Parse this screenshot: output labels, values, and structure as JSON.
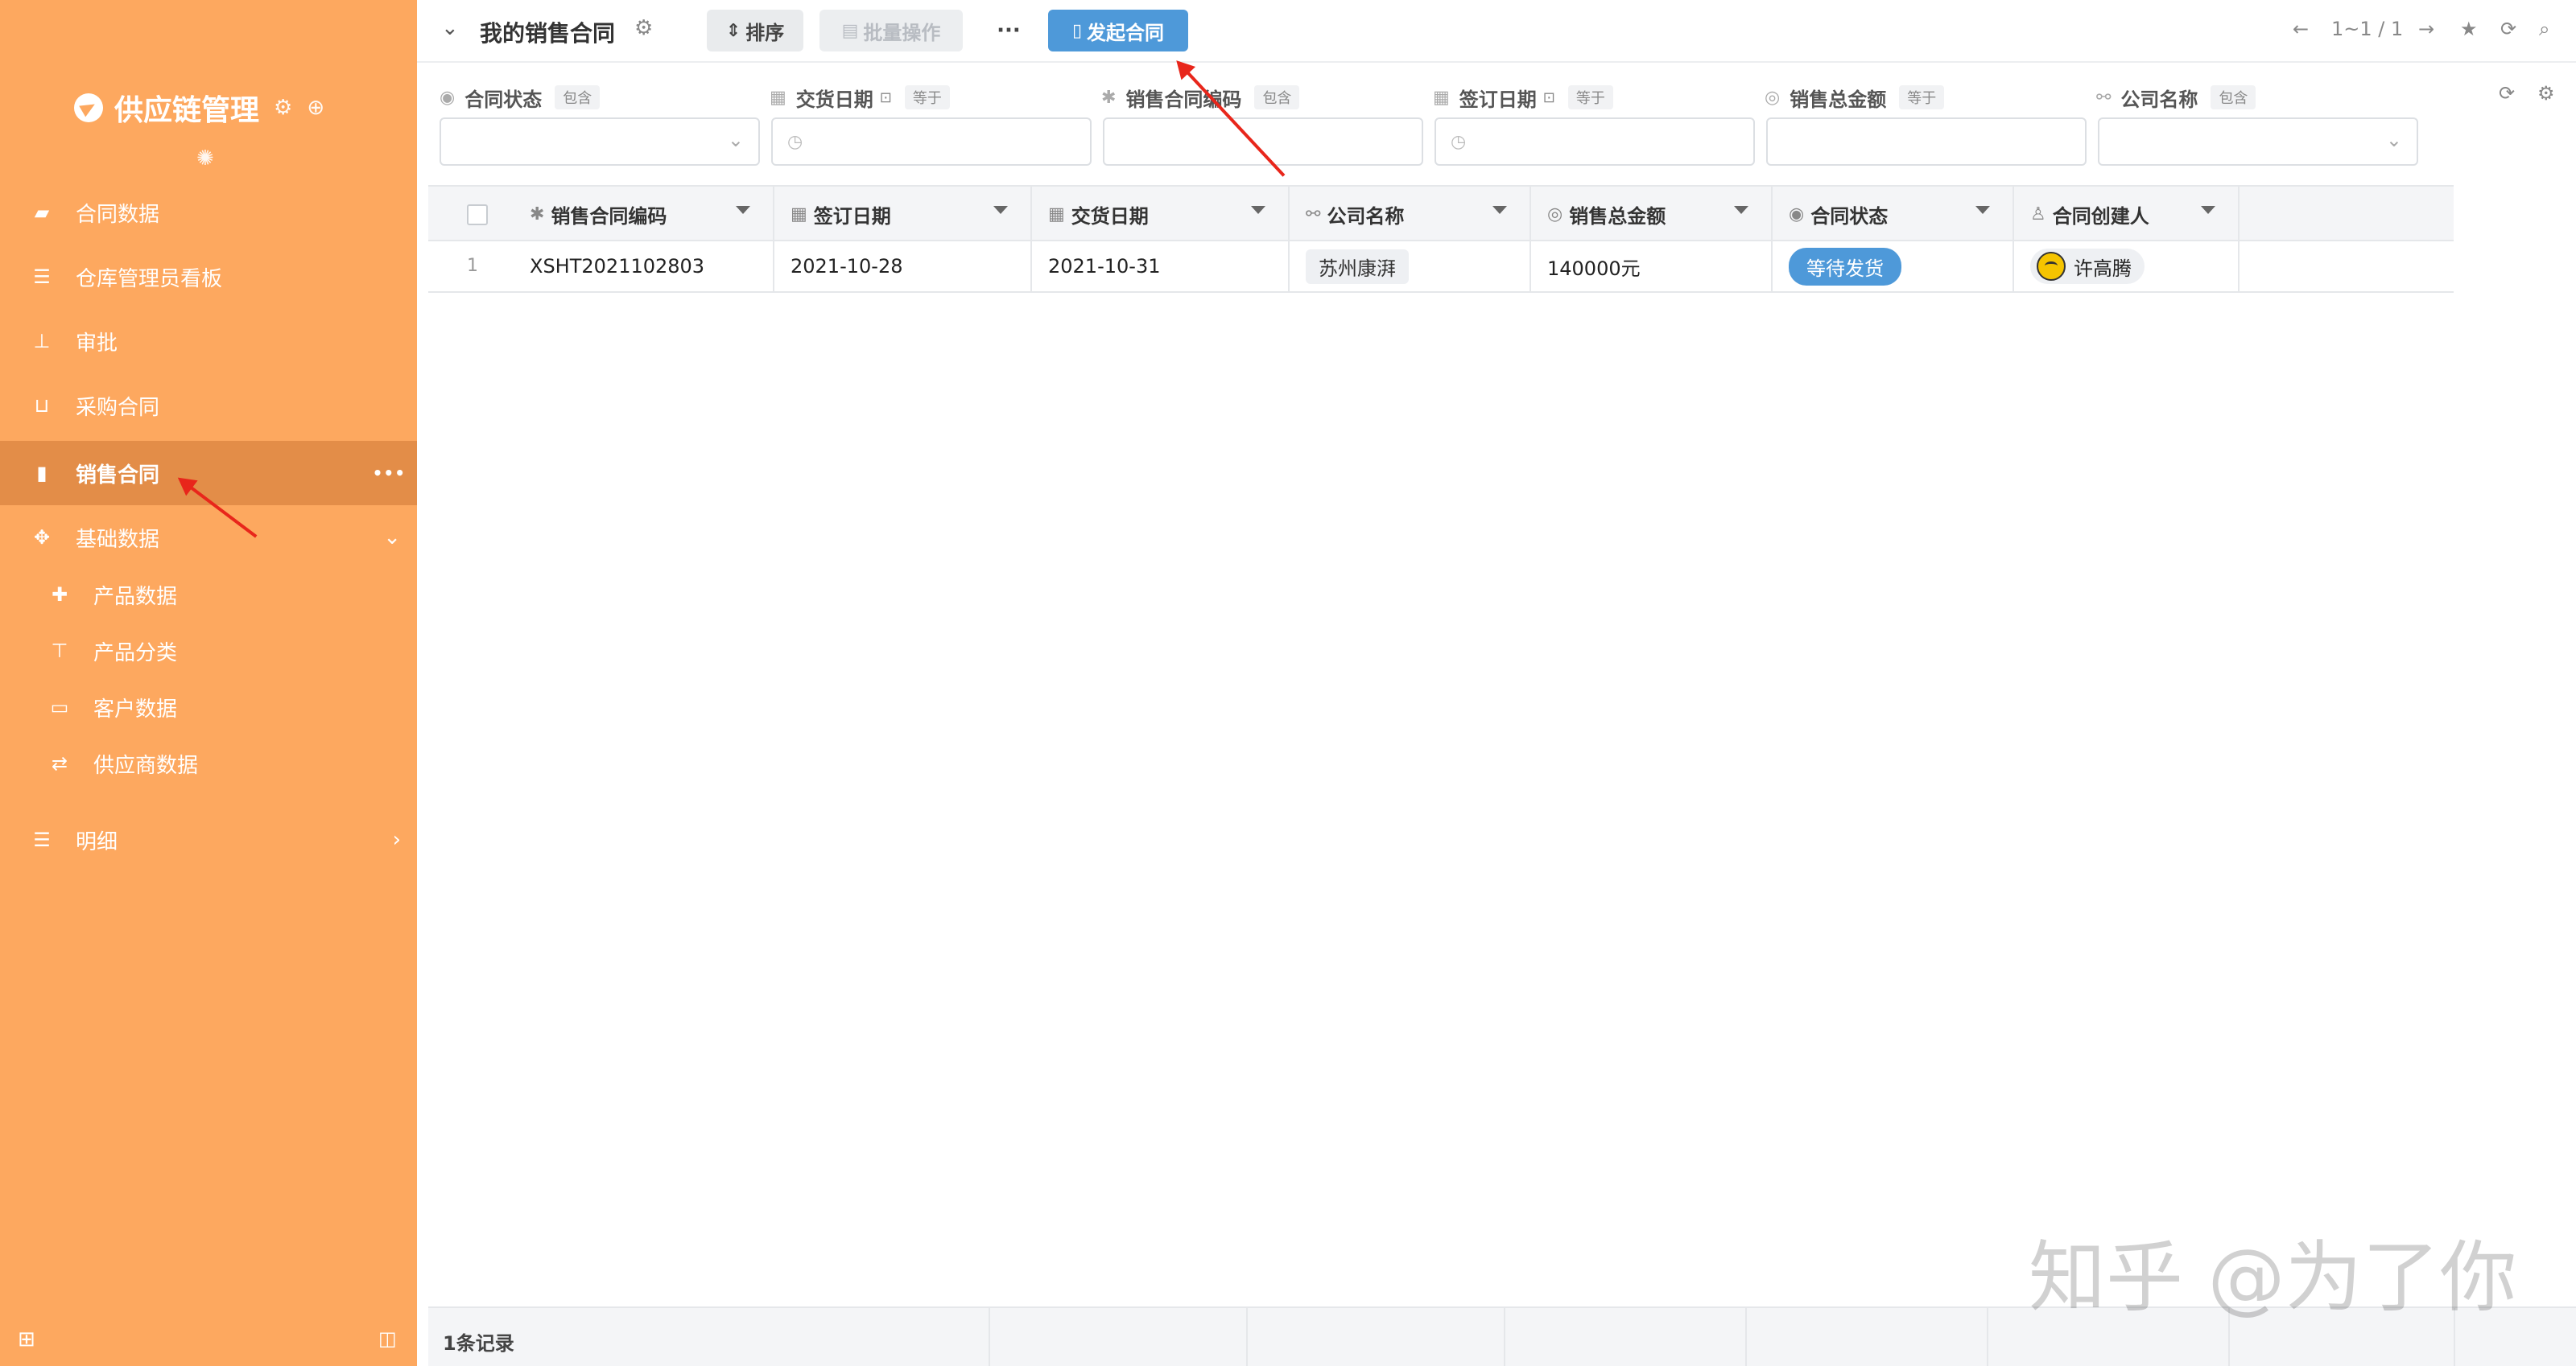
{
  "sidebar": {
    "brand_title": "供应链管理",
    "items": [
      {
        "label": "合同数据",
        "icon": "briefcase-icon"
      },
      {
        "label": "仓库管理员看板",
        "icon": "list-icon"
      },
      {
        "label": "审批",
        "icon": "stamp-icon"
      },
      {
        "label": "采购合同",
        "icon": "basket-icon"
      },
      {
        "label": "销售合同",
        "icon": "book-icon",
        "active": true
      },
      {
        "label": "基础数据",
        "icon": "crosshair-icon",
        "expanded": true
      }
    ],
    "sub_items": [
      {
        "label": "产品数据",
        "icon": "puzzle-icon"
      },
      {
        "label": "产品分类",
        "icon": "signpost-icon"
      },
      {
        "label": "客户数据",
        "icon": "id-card-icon"
      },
      {
        "label": "供应商数据",
        "icon": "exchange-icon"
      }
    ],
    "detail": {
      "label": "明细",
      "icon": "list-icon"
    }
  },
  "toolbar": {
    "title": "我的销售合同",
    "sort_label": "排序",
    "batch_label": "批量操作",
    "more_label": "···",
    "start_contract_label": "发起合同",
    "pagination": "1~1 / 1"
  },
  "filters": [
    {
      "label": "合同状态",
      "op": "包含",
      "icon": "check-circle-icon",
      "input": "select"
    },
    {
      "label": "交货日期",
      "op": "等于",
      "icon": "calendar-icon",
      "input": "date"
    },
    {
      "label": "销售合同编码",
      "op": "包含",
      "icon": "asterisk-icon",
      "input": "text"
    },
    {
      "label": "签订日期",
      "op": "等于",
      "icon": "calendar-icon",
      "input": "date"
    },
    {
      "label": "销售总金额",
      "op": "等于",
      "icon": "coin-icon",
      "input": "text"
    },
    {
      "label": "公司名称",
      "op": "包含",
      "icon": "link-icon",
      "input": "select"
    }
  ],
  "table": {
    "columns": [
      {
        "label": "销售合同编码",
        "icon": "asterisk-icon"
      },
      {
        "label": "签订日期",
        "icon": "calendar-icon"
      },
      {
        "label": "交货日期",
        "icon": "calendar-icon"
      },
      {
        "label": "公司名称",
        "icon": "link-icon"
      },
      {
        "label": "销售总金额",
        "icon": "coin-icon"
      },
      {
        "label": "合同状态",
        "icon": "check-circle-icon"
      },
      {
        "label": "合同创建人",
        "icon": "user-icon"
      }
    ],
    "rows": [
      {
        "num": "1",
        "code": "XSHT2021102803",
        "sign_date": "2021-10-28",
        "delivery_date": "2021-10-31",
        "company": "苏州康湃",
        "amount": "140000元",
        "status": "等待发货",
        "creator": "许高腾"
      }
    ]
  },
  "footer": {
    "count": "1条记录"
  },
  "watermark": "知乎 @为了你",
  "colors": {
    "sidebar": "#fda85f",
    "sidebar_active": "#e38d48",
    "primary": "#4e99d9",
    "annotation_arrow": "#e8261b"
  }
}
